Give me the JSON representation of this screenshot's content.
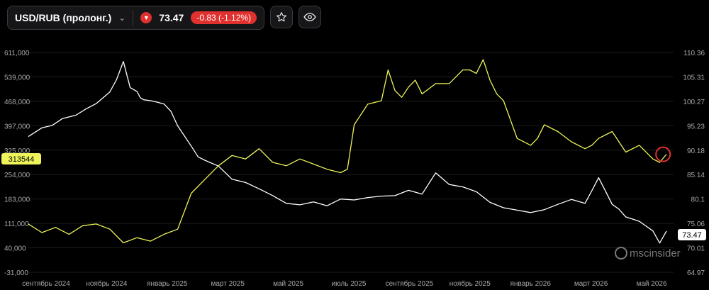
{
  "header": {
    "symbol": "USD/RUB (пролонг.)",
    "price": "73.47",
    "change": "-0.83 (-1.12%)",
    "icons": [
      "chevron-down-icon",
      "down-arrow-icon",
      "star-icon",
      "eye-icon"
    ],
    "colors": {
      "down": "#e0312f",
      "panel": "#161618"
    }
  },
  "chart_data": {
    "type": "line",
    "left_axis": {
      "ticks": [
        "611,000",
        "539,000",
        "468,000",
        "397,000",
        "325,000",
        "254,000",
        "183,000",
        "111,000",
        "40,000",
        "-31,000"
      ],
      "range": [
        -31000,
        611000
      ],
      "current_label": "313544"
    },
    "right_axis": {
      "ticks": [
        "110.36",
        "105.31",
        "100.27",
        "95.23",
        "90.18",
        "85.14",
        "80.1",
        "75.06",
        "70.01",
        "64.97"
      ],
      "range": [
        64.97,
        110.36
      ],
      "current_label": "73.47"
    },
    "x_tick_labels": [
      "сентябрь 2024",
      "ноябрь 2024",
      "январь 2025",
      "март 2025",
      "май 2025",
      "июль 2025",
      "сентябрь 2025",
      "ноябрь 2025",
      "январь 2026",
      "март 2026",
      "май 2026"
    ],
    "x_range": [
      0,
      94
    ],
    "series": [
      {
        "axis": "right",
        "color": "#ffffff",
        "x": [
          0,
          2,
          3.5,
          5,
          7,
          8.5,
          10,
          12,
          13,
          14,
          15,
          16,
          16.5,
          17,
          18,
          19,
          20,
          21,
          22,
          24,
          25,
          26,
          28,
          30,
          32,
          34,
          36,
          38,
          40,
          42,
          44,
          46,
          48,
          50,
          52,
          54,
          56,
          58,
          60,
          62,
          64,
          66,
          68,
          70,
          72,
          74,
          76,
          78,
          80,
          82,
          83,
          84,
          85,
          86,
          87,
          88,
          90,
          92,
          93,
          94
        ],
        "y": [
          93.0,
          94.8,
          95.3,
          96.7,
          97.4,
          98.7,
          99.8,
          102.2,
          104.8,
          108.5,
          103.1,
          102.3,
          101.0,
          100.6,
          100.4,
          100.1,
          99.7,
          98.2,
          95.2,
          91.0,
          88.8,
          88.1,
          86.9,
          84.2,
          83.5,
          82.2,
          80.8,
          79.2,
          78.9,
          79.5,
          78.7,
          80.1,
          79.9,
          80.4,
          80.7,
          80.8,
          81.9,
          81.1,
          85.5,
          83.1,
          82.6,
          81.6,
          79.4,
          78.3,
          77.8,
          77.3,
          77.9,
          79.0,
          80.0,
          79.2,
          81.8,
          84.5,
          81.8,
          79.0,
          78.0,
          76.4,
          75.5,
          73.5,
          71.0,
          73.47
        ]
      },
      {
        "axis": "left",
        "color": "#eef45a",
        "x": [
          0,
          2,
          4,
          6,
          8,
          10,
          12,
          14,
          16,
          18,
          20,
          22,
          24,
          26,
          28,
          30,
          32,
          34,
          36,
          38,
          40,
          42,
          44,
          46,
          47,
          48,
          50,
          52,
          53,
          54,
          55,
          56,
          57,
          58,
          60,
          62,
          63,
          64,
          65,
          66,
          67,
          68,
          69,
          70,
          72,
          74,
          75,
          76,
          78,
          80,
          82,
          83,
          84,
          86,
          88,
          90,
          92,
          93,
          94
        ],
        "y": [
          110000,
          85000,
          100000,
          80000,
          105000,
          110000,
          95000,
          55000,
          70000,
          60000,
          80000,
          95000,
          200000,
          240000,
          280000,
          310000,
          300000,
          330000,
          290000,
          280000,
          300000,
          285000,
          270000,
          260000,
          270000,
          400000,
          460000,
          470000,
          560000,
          500000,
          480000,
          510000,
          530000,
          490000,
          520000,
          520000,
          540000,
          560000,
          560000,
          550000,
          590000,
          530000,
          490000,
          470000,
          360000,
          340000,
          360000,
          400000,
          380000,
          350000,
          330000,
          340000,
          360000,
          380000,
          320000,
          340000,
          300000,
          290000,
          313544
        ]
      }
    ],
    "highlight_marker": {
      "x": 93.5,
      "y": 313544,
      "color": "#e0312f"
    },
    "watermark": "mscinsider"
  }
}
